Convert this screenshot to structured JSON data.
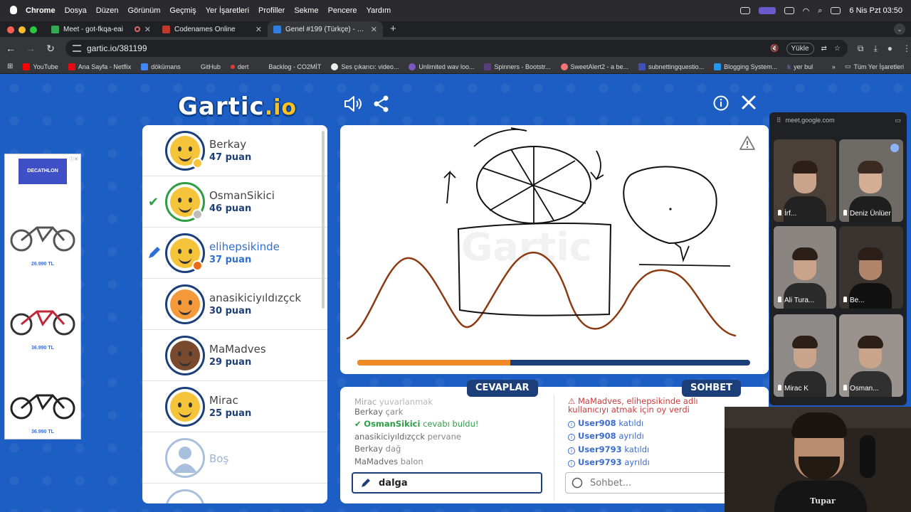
{
  "menubar": {
    "app": "Chrome",
    "items": [
      "Dosya",
      "Düzen",
      "Görünüm",
      "Geçmiş",
      "Yer İşaretleri",
      "Profiller",
      "Sekme",
      "Pencere",
      "Yardım"
    ],
    "datetime": "6 Nis Pzt  03:50"
  },
  "tabs": [
    {
      "title": "Meet - got-fkqa-eai",
      "fav_color": "#34a853",
      "recording": true
    },
    {
      "title": "Codenames Online",
      "fav_color": "#c0392b"
    },
    {
      "title": "Genel #199 (Türkçe) - Gartic",
      "fav_color": "#2f7fe0",
      "active": true
    }
  ],
  "address": {
    "url": "gartic.io/381199",
    "load_label": "Yükle"
  },
  "bookmarks": [
    {
      "label": "YouTube",
      "color": "#ff0000"
    },
    {
      "label": "Ana Sayfa - Netflix",
      "color": "#e50914"
    },
    {
      "label": "dökümans",
      "color": "#4285f4"
    },
    {
      "label": "GitHub",
      "color": "#35363a"
    },
    {
      "label": "dert",
      "color": "#e53935"
    },
    {
      "label": "Backlog - CO2MİT",
      "color": "#35363a"
    },
    {
      "label": "Ses çıkarıcı: video...",
      "color": "#222222"
    },
    {
      "label": "Unlimited wav loo...",
      "color": "#7e57c2"
    },
    {
      "label": "Spinners - Bootstr...",
      "color": "#563d7c"
    },
    {
      "label": "SweetAlert2 - a be...",
      "color": "#f27474"
    },
    {
      "label": "subnettingquestio...",
      "color": "#3f51b5"
    },
    {
      "label": "Blogging System...",
      "color": "#2196f3"
    },
    {
      "label": "yer bul",
      "color": "#6a5acd"
    }
  ],
  "all_bookmarks": "Tüm Yer İşaretleri",
  "gartic": {
    "logo_main": "Gartic",
    "logo_io": ".io",
    "players": [
      {
        "name": "Berkay",
        "points": "47 puan",
        "face": "#f5c43a",
        "dot": "#f5c43a"
      },
      {
        "name": "OsmanSikici",
        "points": "46 puan",
        "face": "#f5c43a",
        "dot": "#bdbdbd",
        "guessed": true
      },
      {
        "name": "elihepsikinde",
        "points": "37 puan",
        "face": "#f5c43a",
        "dot": "#e86c17",
        "drawing": true
      },
      {
        "name": "anasikiciyıldızçck",
        "points": "30 puan",
        "face": "#f59a3a"
      },
      {
        "name": "MaMadves",
        "points": "29 puan",
        "face": "#7a4a2e"
      },
      {
        "name": "Mirac",
        "points": "25 puan",
        "face": "#f5c43a"
      },
      {
        "name": "Boş",
        "points": ""
      }
    ],
    "timer_progress": 0.39,
    "answers_label": "CEVAPLAR",
    "chat_label": "SOHBET",
    "answers": [
      {
        "who": "Mirac",
        "word": "yuvarlanmak",
        "faded": true
      },
      {
        "who": "Berkay",
        "word": "çark"
      },
      {
        "who": "OsmanSikici",
        "word": "cevabı buldu!",
        "correct": true
      },
      {
        "who": "anasikiciyıldızçck",
        "word": "pervane"
      },
      {
        "who": "Berkay",
        "word": "dağ"
      },
      {
        "who": "MaMadves",
        "word": "balon"
      }
    ],
    "chat_alert": "MaMadves, elihepsikinde adlı kullanıcıyı atmak için oy verdi",
    "chat": [
      {
        "user": "User908",
        "action": "katıldı"
      },
      {
        "user": "User908",
        "action": "ayrıldı"
      },
      {
        "user": "User9793",
        "action": "katıldı"
      },
      {
        "user": "User9793",
        "action": "ayrıldı"
      }
    ],
    "answer_input_value": "dalga",
    "chat_placeholder": "Sohbet..."
  },
  "ad": {
    "brand": "DECATHLON",
    "prices": [
      "26.990 TL",
      "36.990 TL",
      "36.990 TL"
    ],
    "bike_colors": [
      "#555555",
      "#c0283a",
      "#222222"
    ]
  },
  "meet": {
    "host": "meet.google.com",
    "tiles": [
      {
        "name": "İrf...",
        "bg": "#4a4038"
      },
      {
        "name": "Deniz Ünlüer",
        "bg": "#6e6a66"
      },
      {
        "name": "Ali Tura...",
        "bg": "#8a8580"
      },
      {
        "name": "Be...",
        "bg": "#3a3430"
      },
      {
        "name": "Mirac K",
        "bg": "#8e8a88"
      },
      {
        "name": "Osman...",
        "bg": "#9a928c"
      }
    ]
  },
  "webcam": {
    "shirt_text": "Tupar"
  }
}
